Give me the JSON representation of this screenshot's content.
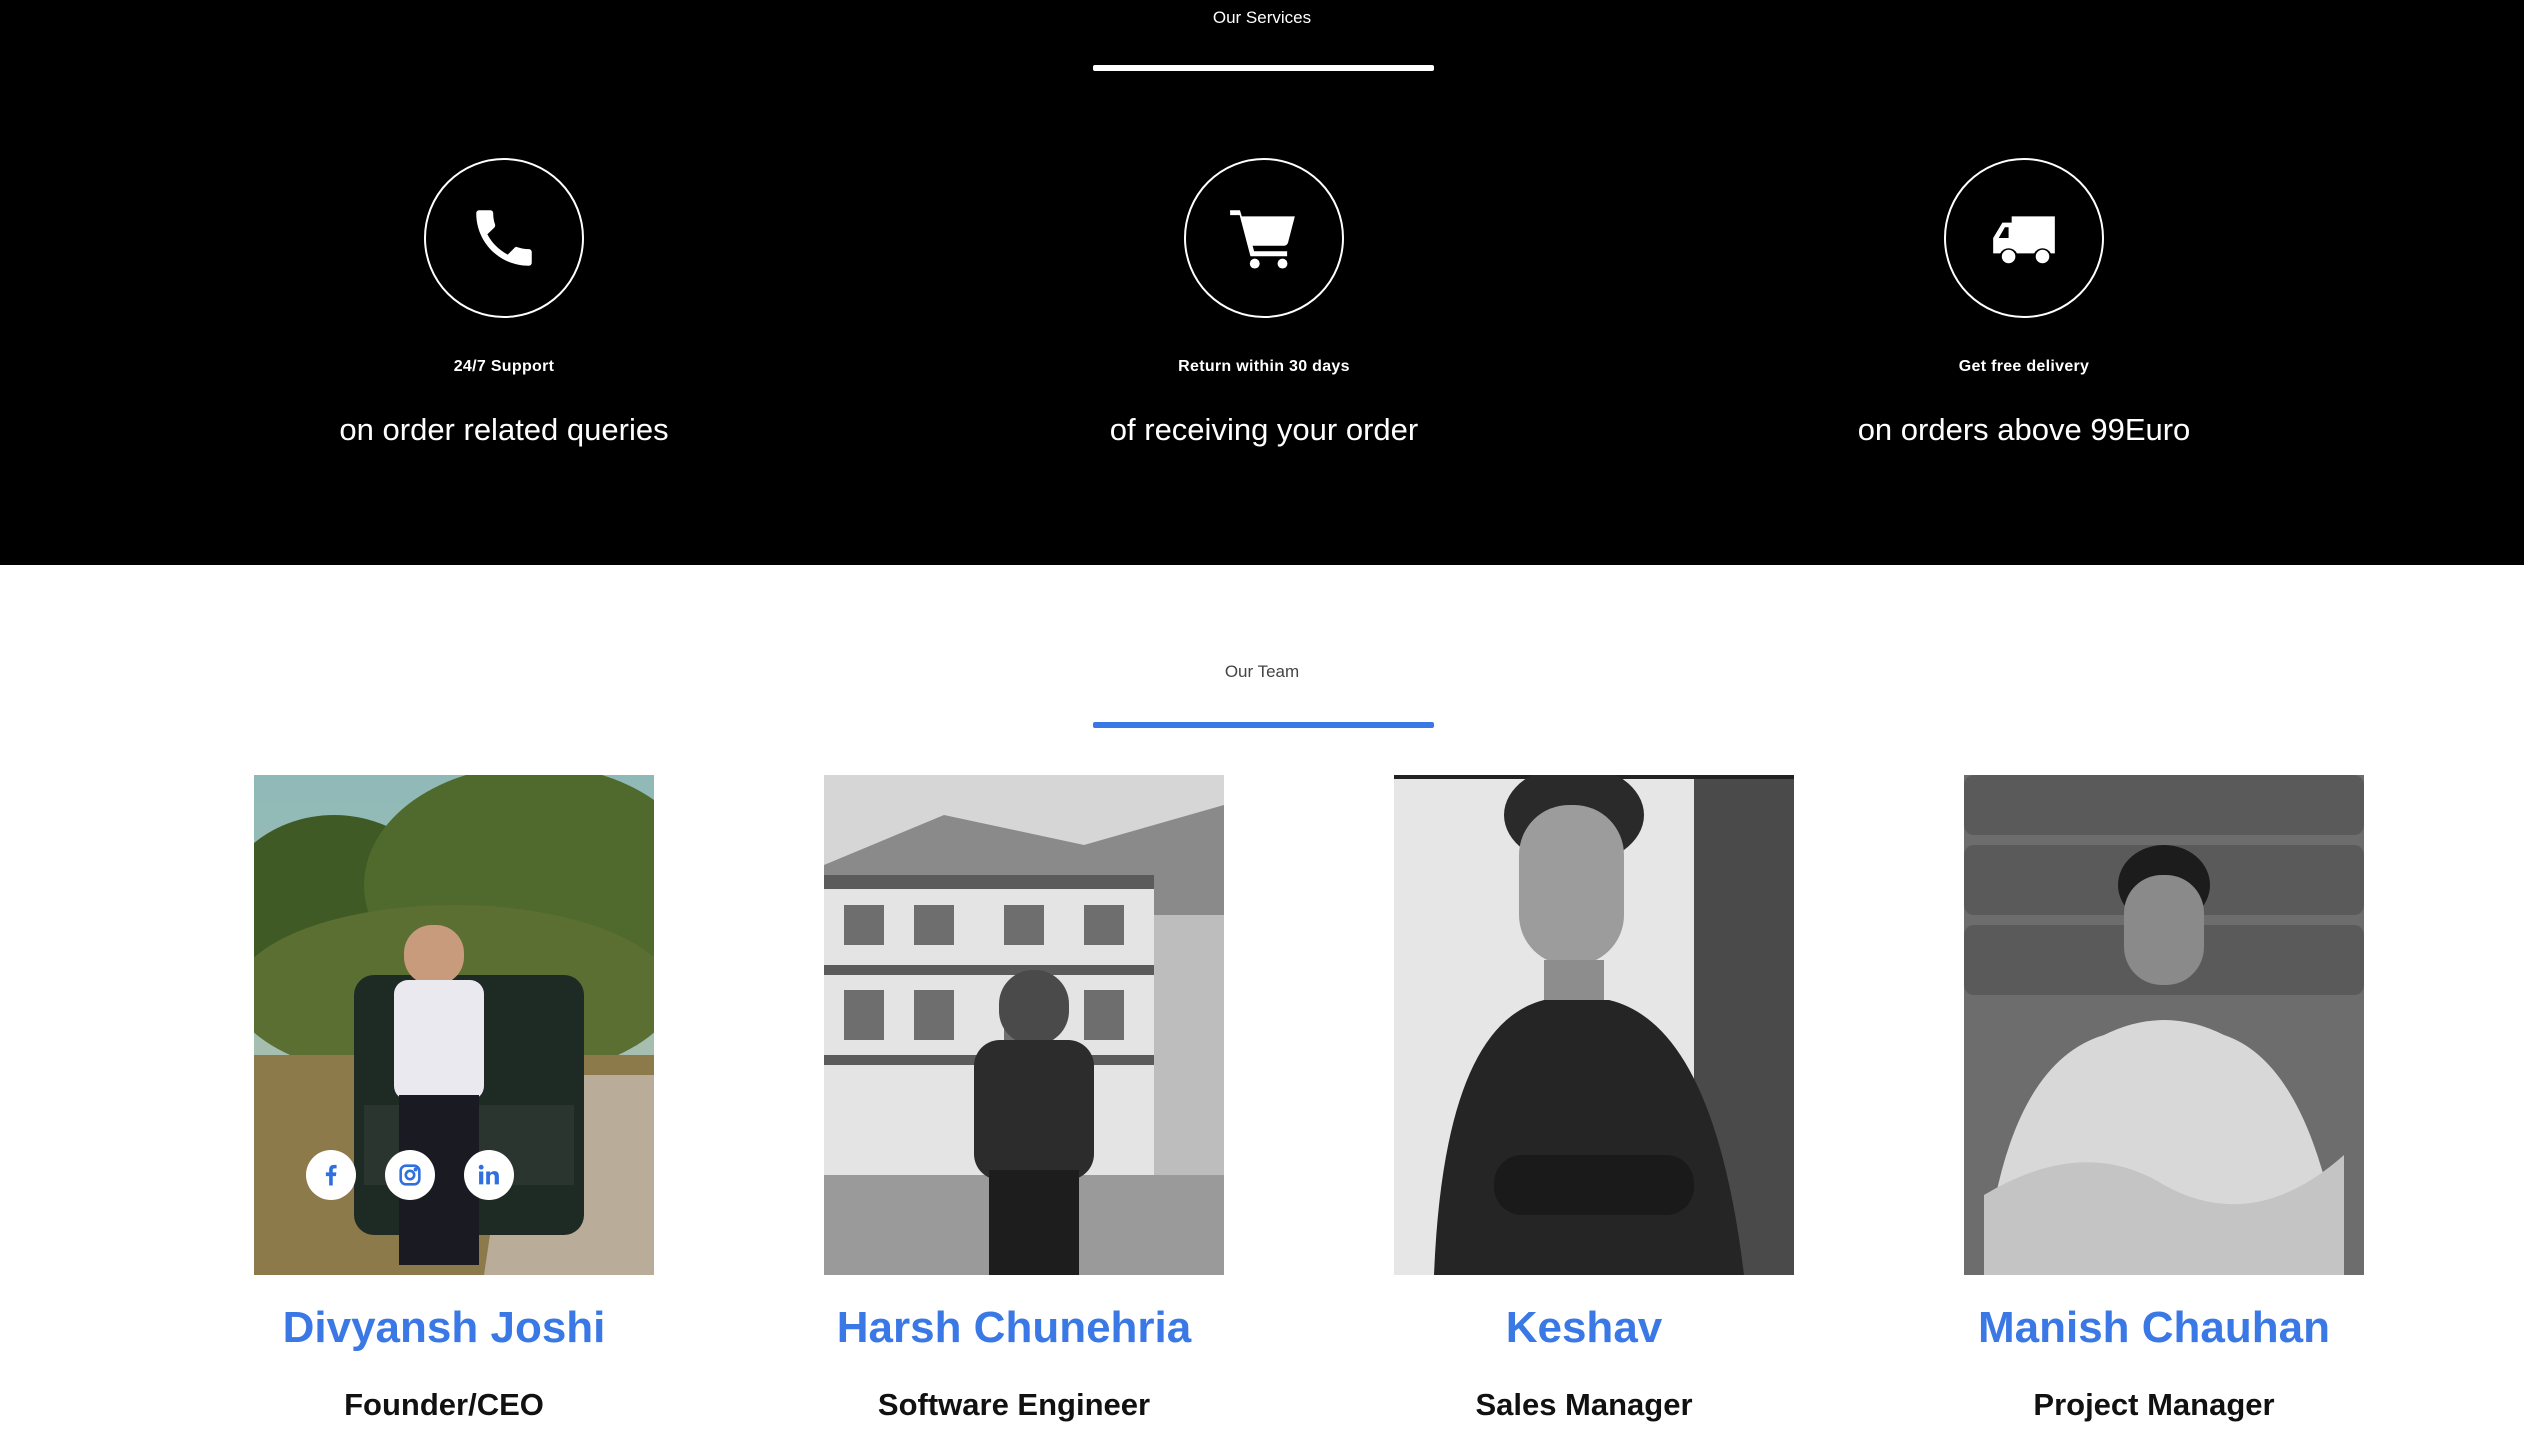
{
  "services": {
    "title": "Our Services",
    "items": [
      {
        "icon": "phone-icon",
        "title": "24/7 Support",
        "desc": "on order related queries"
      },
      {
        "icon": "cart-icon",
        "title": "Return within 30 days",
        "desc": "of receiving your order"
      },
      {
        "icon": "truck-icon",
        "title": "Get free delivery",
        "desc": "on orders above 99Euro"
      }
    ]
  },
  "team": {
    "title": "Our Team",
    "members": [
      {
        "name": "Divyansh Joshi",
        "role": "Founder/CEO"
      },
      {
        "name": "Harsh Chunehria",
        "role": "Software Engineer"
      },
      {
        "name": "Keshav",
        "role": "Sales Manager"
      },
      {
        "name": "Manish Chauhan",
        "role": "Project Manager"
      }
    ],
    "socials": [
      "facebook-icon",
      "instagram-icon",
      "linkedin-icon"
    ]
  },
  "colors": {
    "accent": "#3a78e6",
    "services_bg": "#000000",
    "text_dark": "#111111"
  }
}
